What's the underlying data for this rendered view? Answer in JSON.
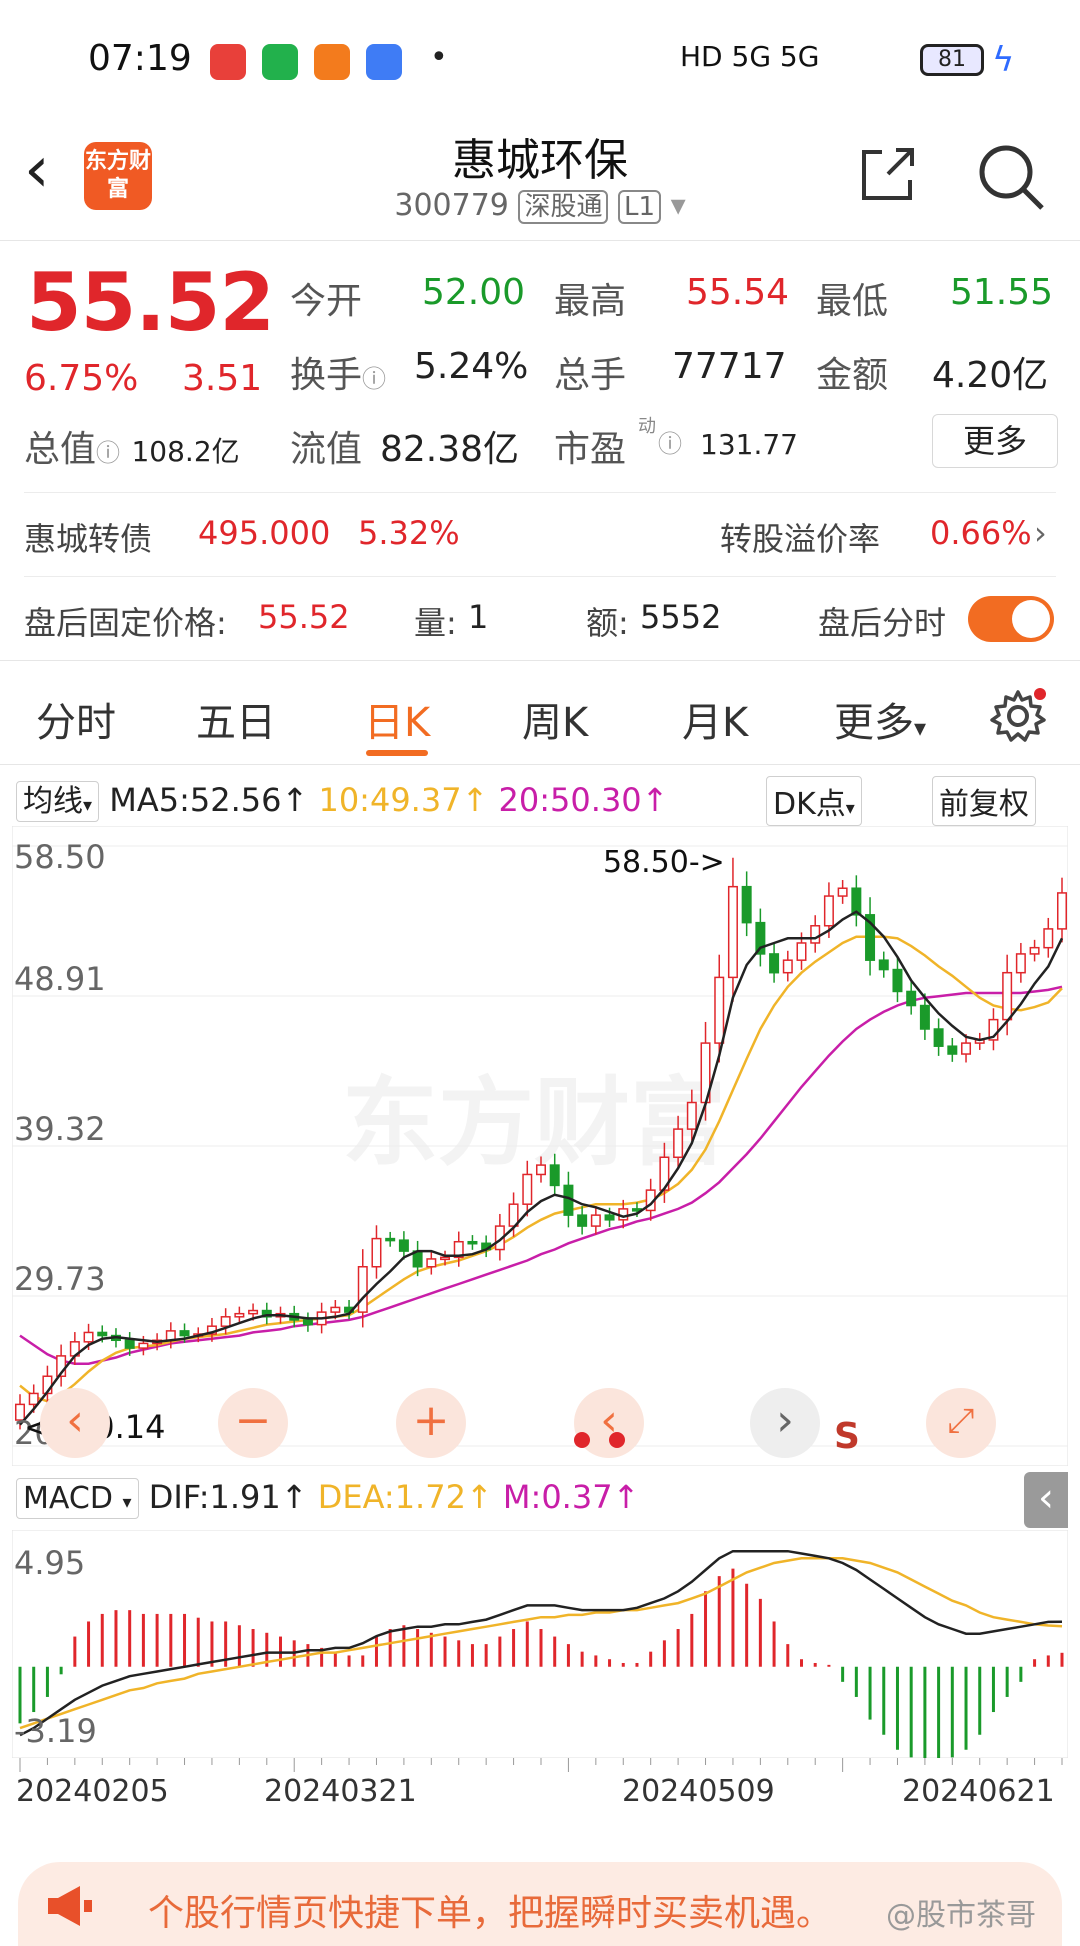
{
  "status_bar": {
    "time": "07:19",
    "network": "HD 5G 5G",
    "battery": "81"
  },
  "header": {
    "back_icon": "chevron-left-icon",
    "logo_text": "东方财富",
    "title": "惠城环保",
    "code": "300779",
    "tag_market": "深股通",
    "tag_level": "L1",
    "share_icon": "share-icon",
    "search_icon": "search-icon"
  },
  "quote": {
    "price": "55.52",
    "change_pct": "6.75%",
    "change": "3.51",
    "open_label": "今开",
    "open": "52.00",
    "high_label": "最高",
    "high": "55.54",
    "low_label": "最低",
    "low": "51.55",
    "turnover_label": "换手",
    "turnover": "5.24%",
    "volume_label": "总手",
    "volume": "77717",
    "amount_label": "金额",
    "amount": "4.20亿",
    "mktcap_label": "总值",
    "mktcap": "108.2亿",
    "float_label": "流值",
    "float": "82.38亿",
    "pe_label": "市盈",
    "pe_sup": "动",
    "pe": "131.77",
    "more_label": "更多"
  },
  "bond": {
    "name": "惠城转债",
    "price": "495.000",
    "pct": "5.32%",
    "premium_label": "转股溢价率",
    "premium": "0.66%"
  },
  "after_hours": {
    "price_label": "盘后固定价格:",
    "price": "55.52",
    "vol_label": "量:",
    "vol": "1",
    "amt_label": "额:",
    "amt": "5552",
    "toggle_label": "盘后分时"
  },
  "tabs": [
    {
      "label": "分时"
    },
    {
      "label": "五日"
    },
    {
      "label": "日K"
    },
    {
      "label": "周K"
    },
    {
      "label": "月K"
    },
    {
      "label": "更多"
    }
  ],
  "kline_legend": {
    "selector": "均线",
    "ma5": "MA5:52.56",
    "ma10": "10:49.37",
    "ma20": "20:50.30",
    "dk": "DK点",
    "adjust": "前复权"
  },
  "macd_legend": {
    "selector": "MACD",
    "dif": "DIF:1.91",
    "dea": "DEA:1.72",
    "m": "M:0.37"
  },
  "colors": {
    "up": "#e0262b",
    "down": "#1a9a2a",
    "ma5": "#222222",
    "ma10": "#f0b429",
    "ma20": "#c81ea8",
    "accent": "#f26c22"
  },
  "chart_data": [
    {
      "type": "candlestick",
      "ylim": [
        20.14,
        58.5
      ],
      "y_ticks": [
        "58.50",
        "48.91",
        "39.32",
        "29.73",
        "20.14"
      ],
      "annotations": {
        "high": "58.50->",
        "low": "<--20.14"
      },
      "signal_label": "S",
      "x_dates": [
        "20240205",
        "20240321",
        "20240509",
        "20240621"
      ],
      "close": [
        22.8,
        23.5,
        24.6,
        25.9,
        26.8,
        27.4,
        27.2,
        26.9,
        26.4,
        26.7,
        26.9,
        27.5,
        27.2,
        27.3,
        27.8,
        28.4,
        28.6,
        28.8,
        28.4,
        28.6,
        28.2,
        27.9,
        28.7,
        29.0,
        28.7,
        31.6,
        33.4,
        33.3,
        32.6,
        31.6,
        32.1,
        32.2,
        33.2,
        33.1,
        32.7,
        34.2,
        35.6,
        37.5,
        38.1,
        36.8,
        34.9,
        34.2,
        34.9,
        34.6,
        35.3,
        35.2,
        36.5,
        38.6,
        40.4,
        42.1,
        45.9,
        50.1,
        55.9,
        53.6,
        51.6,
        50.4,
        51.2,
        52.3,
        53.4,
        55.3,
        55.8,
        54.1,
        51.2,
        50.6,
        49.2,
        48.3,
        46.8,
        45.7,
        45.2,
        45.9,
        46.1,
        47.4,
        50.4,
        51.6,
        52.0,
        53.2,
        55.5
      ],
      "ma5": [
        21.5,
        22.5,
        23.6,
        24.8,
        25.9,
        26.6,
        27.0,
        27.1,
        27.0,
        26.9,
        26.8,
        26.9,
        27.0,
        27.2,
        27.4,
        27.7,
        28.0,
        28.3,
        28.5,
        28.5,
        28.4,
        28.3,
        28.3,
        28.4,
        28.6,
        29.6,
        30.5,
        31.3,
        32.2,
        32.6,
        32.6,
        32.3,
        32.3,
        32.4,
        32.7,
        33.3,
        34.1,
        35.1,
        35.8,
        36.2,
        36.0,
        35.6,
        35.4,
        35.1,
        34.8,
        35.0,
        35.6,
        36.6,
        37.9,
        39.5,
        42.0,
        45.1,
        48.8,
        50.9,
        52.0,
        52.3,
        52.6,
        52.6,
        52.6,
        53.1,
        53.8,
        54.3,
        53.6,
        52.7,
        51.4,
        49.9,
        48.8,
        47.8,
        47.0,
        46.3,
        46.1,
        46.3,
        47.3,
        48.4,
        49.7,
        50.8,
        52.6
      ],
      "ma10": [
        24.0,
        23.3,
        23.0,
        23.4,
        24.1,
        24.9,
        25.6,
        26.1,
        26.4,
        26.5,
        26.6,
        26.8,
        27.0,
        27.1,
        27.2,
        27.3,
        27.5,
        27.7,
        27.9,
        28.0,
        28.1,
        28.2,
        28.3,
        28.4,
        28.5,
        29.0,
        29.6,
        30.2,
        30.8,
        31.3,
        31.6,
        31.8,
        32.0,
        32.3,
        32.6,
        33.0,
        33.5,
        34.1,
        34.6,
        35.0,
        35.2,
        35.4,
        35.6,
        35.6,
        35.6,
        35.7,
        35.9,
        36.3,
        36.9,
        37.8,
        39.1,
        40.9,
        42.9,
        44.9,
        46.8,
        48.3,
        49.5,
        50.4,
        51.1,
        51.7,
        52.3,
        52.7,
        52.7,
        52.7,
        52.6,
        52.1,
        51.5,
        50.8,
        50.2,
        49.5,
        48.8,
        48.3,
        48.1,
        48.0,
        48.2,
        48.5,
        49.4
      ],
      "ma20": [
        27.2,
        26.6,
        26.0,
        25.6,
        25.4,
        25.4,
        25.6,
        25.8,
        26.1,
        26.3,
        26.5,
        26.7,
        26.8,
        26.9,
        27.0,
        27.1,
        27.2,
        27.4,
        27.5,
        27.6,
        27.8,
        27.9,
        28.0,
        28.1,
        28.2,
        28.4,
        28.7,
        29.0,
        29.3,
        29.6,
        29.9,
        30.2,
        30.5,
        30.8,
        31.1,
        31.4,
        31.7,
        32.0,
        32.4,
        32.7,
        33.1,
        33.4,
        33.7,
        34.0,
        34.2,
        34.5,
        34.7,
        35.0,
        35.3,
        35.7,
        36.3,
        37.0,
        37.9,
        38.8,
        39.8,
        40.9,
        42.0,
        43.1,
        44.1,
        45.1,
        46.0,
        46.8,
        47.4,
        47.9,
        48.3,
        48.6,
        48.8,
        48.9,
        49.0,
        49.1,
        49.1,
        49.1,
        49.1,
        49.1,
        49.2,
        49.3,
        49.5
      ]
    },
    {
      "type": "macd",
      "ylim": [
        -3.19,
        4.95
      ],
      "y_ticks": [
        "4.95",
        "-3.19"
      ],
      "dif": [
        -2.9,
        -2.6,
        -2.2,
        -1.8,
        -1.4,
        -1.1,
        -0.8,
        -0.6,
        -0.4,
        -0.3,
        -0.2,
        -0.1,
        0.0,
        0.1,
        0.2,
        0.3,
        0.4,
        0.5,
        0.6,
        0.6,
        0.6,
        0.7,
        0.7,
        0.8,
        0.8,
        1.0,
        1.3,
        1.5,
        1.6,
        1.7,
        1.7,
        1.8,
        1.8,
        1.9,
        2.0,
        2.2,
        2.4,
        2.6,
        2.6,
        2.6,
        2.5,
        2.4,
        2.4,
        2.4,
        2.4,
        2.5,
        2.7,
        2.9,
        3.2,
        3.6,
        4.1,
        4.6,
        4.9,
        4.9,
        4.9,
        4.9,
        4.9,
        4.8,
        4.7,
        4.6,
        4.4,
        4.1,
        3.7,
        3.3,
        2.9,
        2.5,
        2.1,
        1.8,
        1.6,
        1.4,
        1.4,
        1.5,
        1.6,
        1.7,
        1.8,
        1.9,
        1.91
      ],
      "dea": [
        -2.6,
        -2.4,
        -2.2,
        -2.0,
        -1.8,
        -1.6,
        -1.4,
        -1.2,
        -1.0,
        -0.9,
        -0.7,
        -0.6,
        -0.5,
        -0.3,
        -0.2,
        -0.1,
        0.0,
        0.1,
        0.2,
        0.3,
        0.4,
        0.5,
        0.6,
        0.6,
        0.7,
        0.8,
        0.9,
        1.0,
        1.1,
        1.2,
        1.3,
        1.4,
        1.5,
        1.6,
        1.7,
        1.8,
        1.9,
        2.0,
        2.1,
        2.1,
        2.2,
        2.2,
        2.3,
        2.3,
        2.4,
        2.4,
        2.5,
        2.6,
        2.7,
        2.9,
        3.1,
        3.4,
        3.7,
        4.0,
        4.2,
        4.4,
        4.5,
        4.6,
        4.6,
        4.6,
        4.6,
        4.5,
        4.4,
        4.2,
        4.0,
        3.7,
        3.4,
        3.1,
        2.8,
        2.6,
        2.3,
        2.1,
        2.0,
        1.9,
        1.8,
        1.75,
        1.72
      ],
      "m": [
        -1.5,
        -1.2,
        -0.8,
        -0.2,
        0.8,
        1.2,
        1.4,
        1.5,
        1.5,
        1.4,
        1.4,
        1.4,
        1.4,
        1.3,
        1.2,
        1.2,
        1.1,
        1.0,
        0.9,
        0.8,
        0.7,
        0.6,
        0.5,
        0.4,
        0.3,
        0.3,
        0.8,
        1.0,
        1.1,
        1.0,
        0.9,
        0.8,
        0.7,
        0.6,
        0.6,
        0.8,
        1.0,
        1.2,
        1.0,
        0.8,
        0.6,
        0.4,
        0.3,
        0.2,
        0.1,
        0.1,
        0.4,
        0.7,
        1.0,
        1.4,
        2.0,
        2.4,
        2.6,
        2.2,
        1.8,
        1.2,
        0.6,
        0.2,
        0.1,
        0.05,
        -0.4,
        -0.8,
        -1.4,
        -1.8,
        -2.2,
        -2.4,
        -2.6,
        -2.6,
        -2.4,
        -2.2,
        -1.8,
        -1.2,
        -0.8,
        -0.4,
        0.2,
        0.3,
        0.37
      ]
    }
  ],
  "controls": {
    "prev_icon": "chevron-left-icon",
    "next_icon": "chevron-right-icon",
    "zoom_out_icon": "minus-icon",
    "zoom_in_icon": "plus-icon",
    "expand_icon": "expand-icon"
  },
  "banner": {
    "text": "个股行情页快捷下单，把握瞬时买卖机遇。",
    "icon": "megaphone-icon",
    "watermark": "@股市茶哥"
  }
}
